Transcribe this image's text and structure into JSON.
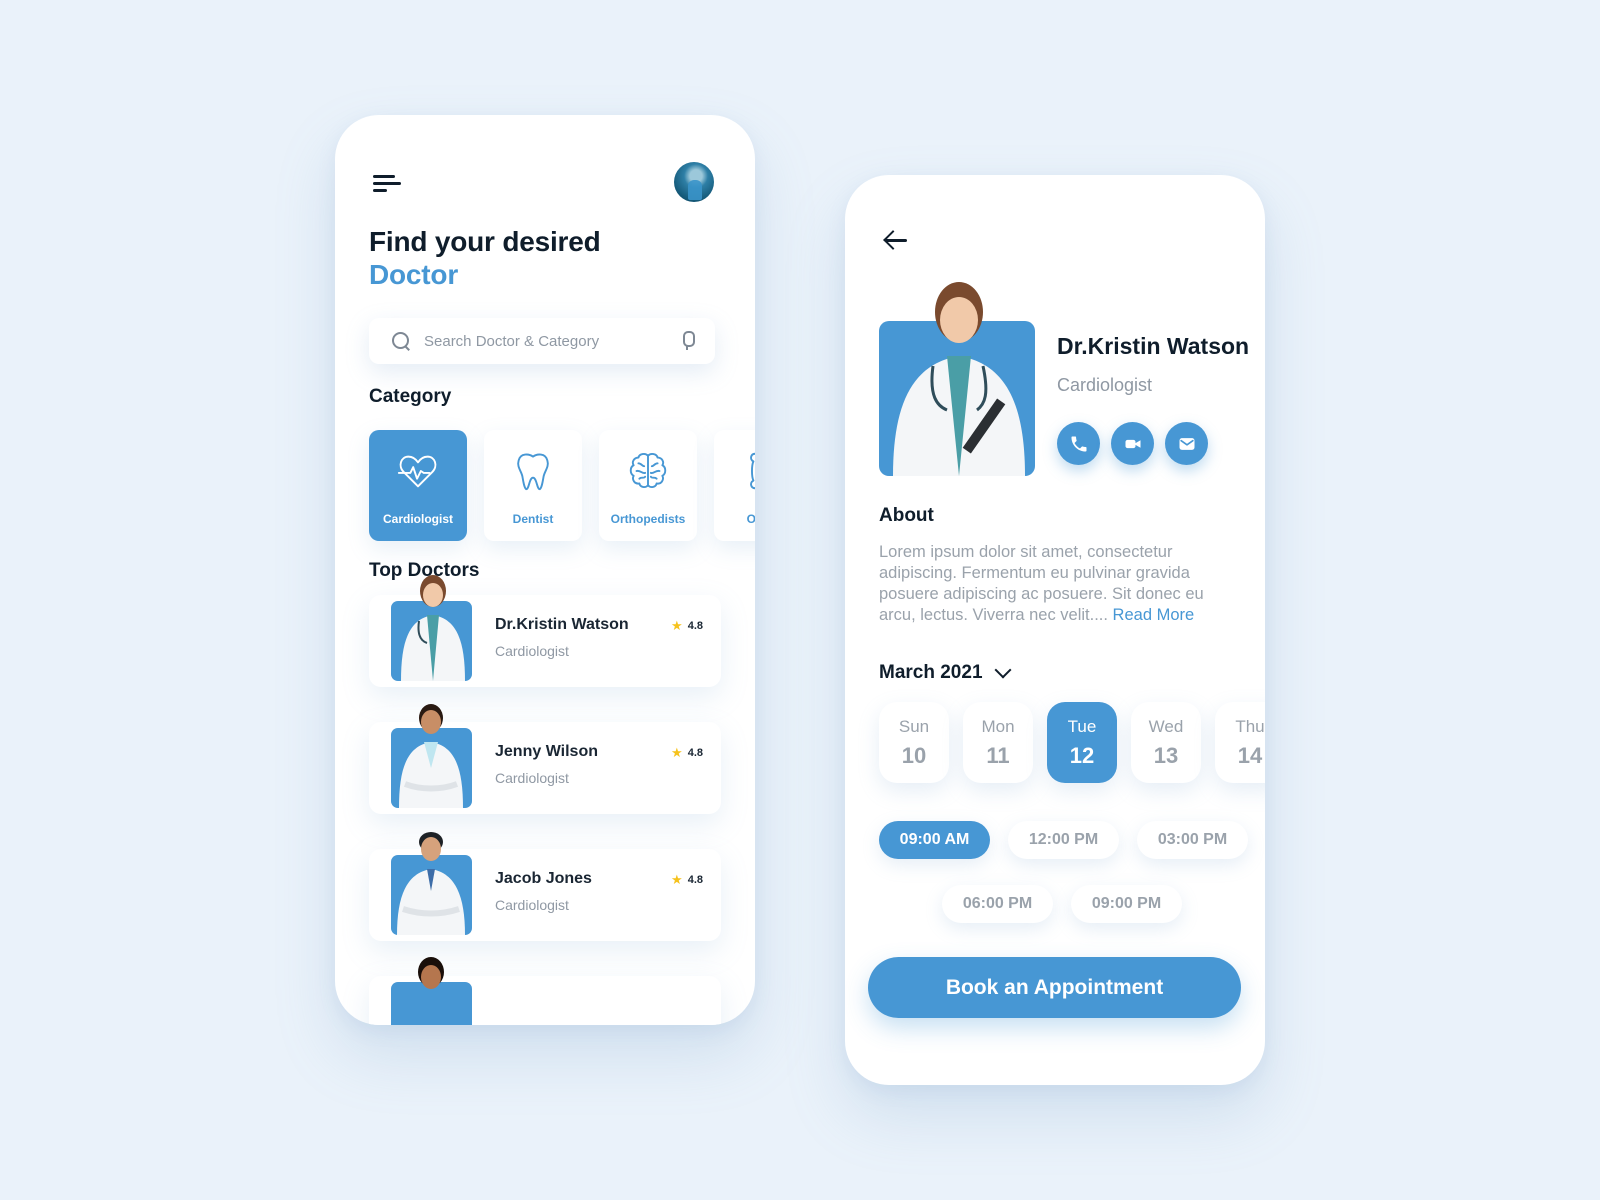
{
  "colors": {
    "background": "#eaf2fa",
    "accent": "#4797d4",
    "text_dark": "#0f1d2b",
    "text_muted": "#8f98a3",
    "star": "#f6c21c"
  },
  "home": {
    "menu_icon": "menu-icon",
    "avatar_icon": "user-avatar",
    "headline_line1": "Find your desired",
    "headline_line2": "Doctor",
    "search": {
      "placeholder": "Search Doctor & Category",
      "value": "",
      "left_icon": "search-icon",
      "right_icon": "microphone-icon"
    },
    "category_title": "Category",
    "categories": [
      {
        "label": "Cardiologist",
        "icon": "heart-pulse-icon",
        "active": true
      },
      {
        "label": "Dentist",
        "icon": "tooth-icon",
        "active": false
      },
      {
        "label": "Orthopedists",
        "icon": "brain-icon",
        "active": false
      },
      {
        "label": "Ortho",
        "icon": "bone-icon",
        "active": false
      }
    ],
    "top_doctors_title": "Top Doctors",
    "doctors": [
      {
        "name": "Dr.Kristin Watson",
        "specialty": "Cardiologist",
        "rating": "4.8"
      },
      {
        "name": "Jenny Wilson",
        "specialty": "Cardiologist",
        "rating": "4.8"
      },
      {
        "name": "Jacob Jones",
        "specialty": "Cardiologist",
        "rating": "4.8"
      },
      {
        "name": "",
        "specialty": "",
        "rating": ""
      }
    ]
  },
  "detail": {
    "back_icon": "arrow-left-icon",
    "doctor_name": "Dr.Kristin Watson",
    "specialty": "Cardiologist",
    "actions": [
      {
        "icon": "phone-icon",
        "label": "Call"
      },
      {
        "icon": "video-icon",
        "label": "Video call"
      },
      {
        "icon": "mail-icon",
        "label": "Message"
      }
    ],
    "about_title": "About",
    "about_text": "Lorem ipsum dolor sit amet, consectetur adipiscing. Fermentum eu pulvinar gravida posuere adipiscing ac posuere. Sit donec eu arcu, lectus. Viverra nec velit.... ",
    "read_more": "Read More",
    "month": "March 2021",
    "days": [
      {
        "name": "Sun",
        "num": "10",
        "active": false
      },
      {
        "name": "Mon",
        "num": "11",
        "active": false
      },
      {
        "name": "Tue",
        "num": "12",
        "active": true
      },
      {
        "name": "Wed",
        "num": "13",
        "active": false
      },
      {
        "name": "Thu",
        "num": "14",
        "active": false
      }
    ],
    "time_slots": [
      {
        "label": "09:00 AM",
        "active": true
      },
      {
        "label": "12:00 PM",
        "active": false
      },
      {
        "label": "03:00 PM",
        "active": false
      },
      {
        "label": "06:00 PM",
        "active": false
      },
      {
        "label": "09:00 PM",
        "active": false
      }
    ],
    "book_button": "Book an Appointment"
  }
}
